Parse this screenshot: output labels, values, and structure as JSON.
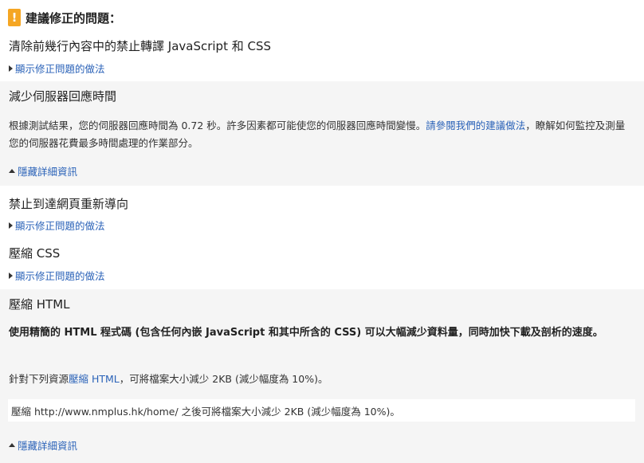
{
  "header": {
    "icon": "!",
    "title": "建議修正的問題："
  },
  "rules": {
    "js_css": {
      "title": "清除前幾行內容中的禁止轉譯 JavaScript 和 CSS",
      "toggle": "顯示修正問題的做法"
    },
    "server": {
      "title": "減少伺服器回應時間",
      "desc_1": "根據測試結果，您的伺服器回應時間為 0.72 秒。許多因素都可能使您的伺服器回應時間變慢。",
      "desc_link": "請參閱我們的建議做法",
      "desc_2": "，瞭解如何監控及測量您的伺服器花費最多時間處理的作業部分。",
      "toggle": "隱藏詳細資訊"
    },
    "redirect": {
      "title": "禁止到達網頁重新導向",
      "toggle": "顯示修正問題的做法"
    },
    "min_css": {
      "title": "壓縮 CSS",
      "toggle": "顯示修正問題的做法"
    },
    "min_html": {
      "title": "壓縮 HTML",
      "bold_desc": "使用精簡的 HTML 程式碼 (包含任何內嵌 JavaScript 和其中所含的 CSS) 可以大幅減少資料量，同時加快下載及剖析的速度。",
      "resource_1": "針對下列資源",
      "resource_link": "壓縮 HTML",
      "resource_2": "，可將檔案大小減少 2KB (減少幅度為 10%)。",
      "url_line": "壓縮 http://www.nmplus.hk/home/ 之後可將檔案大小減少 2KB (減少幅度為 10%)。",
      "toggle": "隱藏詳細資訊"
    }
  }
}
